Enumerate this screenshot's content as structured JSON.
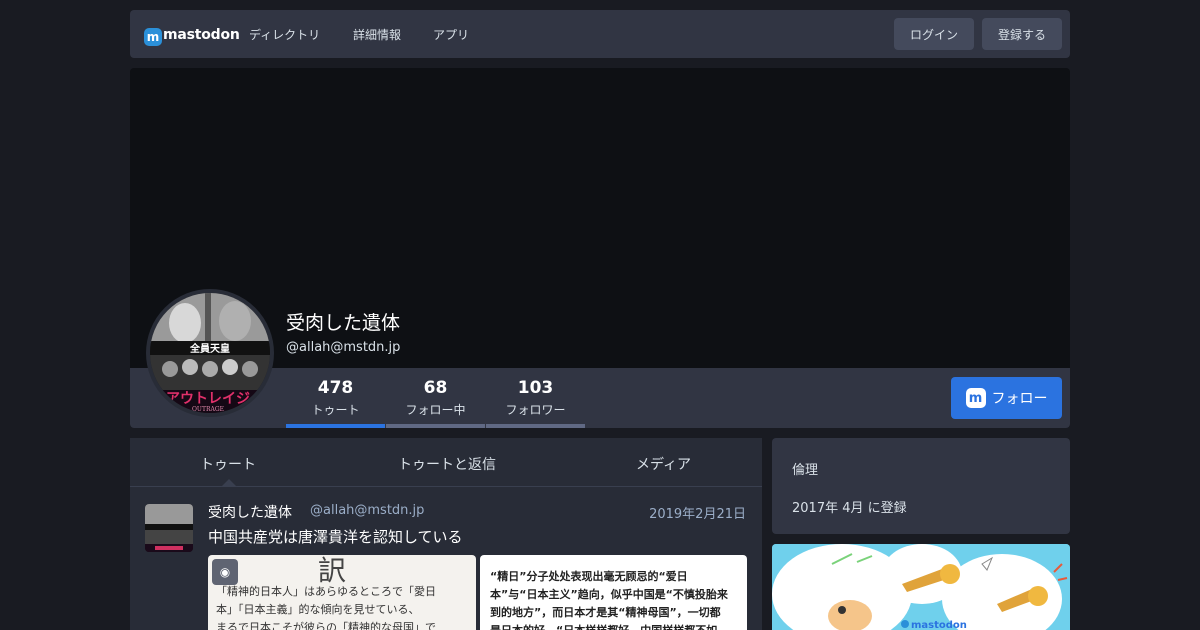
{
  "navbar": {
    "brand": "mastodon",
    "links": [
      "ディレクトリ",
      "詳細情報",
      "アプリ"
    ],
    "login_label": "ログイン",
    "signup_label": "登録する"
  },
  "profile": {
    "display_name": "受肉した遺体",
    "acct": "@allah@mstdn.jp",
    "avatar_text_top": "全員天皇",
    "avatar_text_bottom": "アウトレイジ",
    "avatar_text_caption": "OUTRAGE",
    "counters": [
      {
        "value": "478",
        "label": "トゥート"
      },
      {
        "value": "68",
        "label": "フォロー中"
      },
      {
        "value": "103",
        "label": "フォロワー"
      }
    ],
    "follow_label": "フォロー"
  },
  "tabs": [
    "トゥート",
    "トゥートと返信",
    "メディア"
  ],
  "status": {
    "display_name": "受肉した遺体",
    "acct": "@allah@mstdn.jp",
    "time": "2019年2月21日",
    "content": "中国共産党は唐澤貴洋を認知している",
    "media1_lines": [
      "訳",
      "「精神的日本人」はあらゆるところで「愛日",
      "本」「日本主義」的な傾向を見せている、",
      "まるで日本こそが彼らの「精神的な母国」で"
    ],
    "media2_lines": [
      "“精日”分子处处表现出毫无顾忌的“爱日",
      "本”与“日本主义”趋向，似乎中国是“不慎投胎来",
      "到的地方”，而日本才是其“精神母国”，一切都",
      "是日本的好，“日本样样都好，中国样样都不如"
    ]
  },
  "sidebar": {
    "bio": "倫理",
    "joined": "2017年 4月 に登録"
  },
  "promo": {
    "brand": "mastodon"
  },
  "colors": {
    "accent": "#2b73e0",
    "background": "#191b22",
    "panel": "#282c37"
  }
}
